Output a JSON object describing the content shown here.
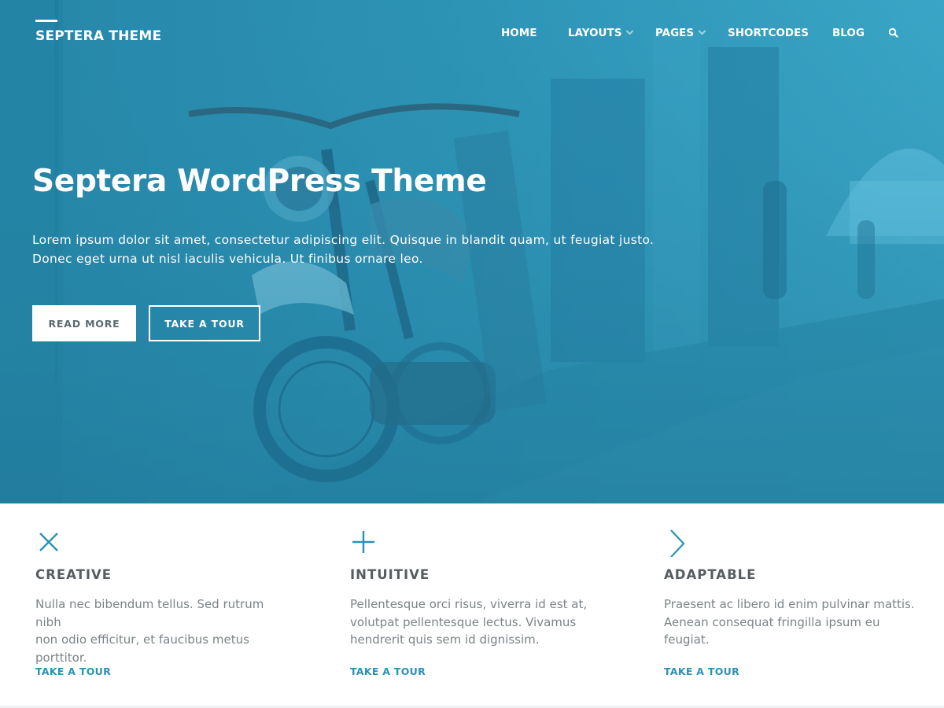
{
  "colors": {
    "accent": "#2b91b3",
    "hero_overlay": "#2b91b3",
    "text_dark": "#555d61",
    "text_muted": "#7b8487"
  },
  "header": {
    "logo": "SEPTERA THEME",
    "nav": [
      {
        "label": "HOME",
        "has_dropdown": false
      },
      {
        "label": "LAYOUTS",
        "has_dropdown": true
      },
      {
        "label": "PAGES",
        "has_dropdown": true
      },
      {
        "label": "SHORTCODES",
        "has_dropdown": false
      },
      {
        "label": "BLOG",
        "has_dropdown": false
      }
    ],
    "search_icon": "search-icon"
  },
  "hero": {
    "title": "Septera WordPress Theme",
    "text_line1": "Lorem ipsum dolor sit amet, consectetur adipiscing elit. Quisque in blandit quam, ut feugiat justo.",
    "text_line2": "Donec eget urna ut nisl iaculis vehicula. Ut finibus ornare leo.",
    "button_primary": "READ MORE",
    "button_secondary": "TAKE A TOUR"
  },
  "features": [
    {
      "icon": "close-x-icon",
      "title": "CREATIVE",
      "desc_lines": [
        "Nulla nec bibendum tellus. Sed rutrum nibh",
        "non odio efficitur, et faucibus metus",
        "porttitor."
      ],
      "link": "TAKE A TOUR"
    },
    {
      "icon": "plus-icon",
      "title": "INTUITIVE",
      "desc_lines": [
        "Pellentesque orci risus, viverra id est at,",
        "volutpat pellentesque lectus. Vivamus",
        "hendrerit quis sem id dignissim."
      ],
      "link": "TAKE A TOUR"
    },
    {
      "icon": "chevron-right-icon",
      "title": "ADAPTABLE",
      "desc_lines": [
        "Praesent ac libero id enim pulvinar mattis.",
        "Aenean consequat fringilla ipsum eu",
        "feugiat."
      ],
      "link": "TAKE A TOUR"
    }
  ]
}
